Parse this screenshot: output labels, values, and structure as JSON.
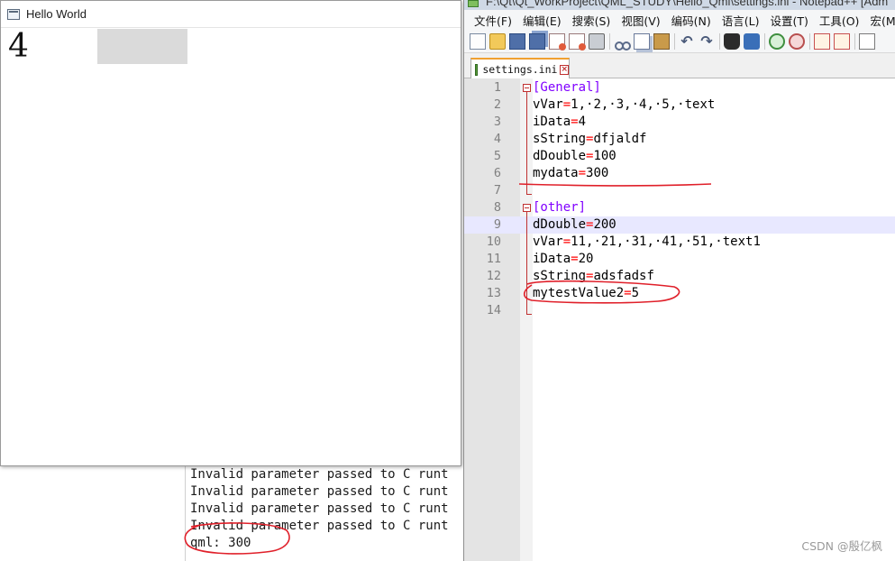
{
  "hello_window": {
    "title": "Hello World",
    "number_text": "4"
  },
  "console": {
    "lines": [
      "Invalid parameter passed to C runt",
      "Invalid parameter passed to C runt",
      "Invalid parameter passed to C runt",
      "Invalid parameter passed to C runt",
      "qml: 300"
    ]
  },
  "notepad": {
    "title": "F:\\Qt\\Qt_WorkProject\\QML_STUDY\\Hello_Qml\\settings.ini - Notepad++ [Adm",
    "menu": [
      "文件(F)",
      "编辑(E)",
      "搜索(S)",
      "视图(V)",
      "编码(N)",
      "语言(L)",
      "设置(T)",
      "工具(O)",
      "宏(M)"
    ],
    "toolbar_icons": [
      "new-file-icon",
      "open-folder-icon",
      "save-icon",
      "save-all-icon",
      "close-icon",
      "close-all-icon",
      "print-icon",
      "cut-icon",
      "copy-icon",
      "paste-icon",
      "undo-icon",
      "redo-icon",
      "find-icon",
      "replace-icon",
      "zoom-in-icon",
      "zoom-out-icon",
      "sync-scroll-icon",
      "word-wrap-icon"
    ],
    "tab": {
      "label": "settings.ini"
    },
    "lines": [
      {
        "n": "1",
        "text": "[General]",
        "type": "section"
      },
      {
        "n": "2",
        "key": "vVar",
        "value": "1,·2,·3,·4,·5,·text"
      },
      {
        "n": "3",
        "key": "iData",
        "value": "4"
      },
      {
        "n": "4",
        "key": "sString",
        "value": "dfjaldf"
      },
      {
        "n": "5",
        "key": "dDouble",
        "value": "100"
      },
      {
        "n": "6",
        "key": "mydata",
        "value": "300"
      },
      {
        "n": "7",
        "text": "",
        "type": "blank"
      },
      {
        "n": "8",
        "text": "[other]",
        "type": "section"
      },
      {
        "n": "9",
        "key": "dDouble",
        "value": "200",
        "current": true
      },
      {
        "n": "10",
        "key": "vVar",
        "value": "11,·21,·31,·41,·51,·text1"
      },
      {
        "n": "11",
        "key": "iData",
        "value": "20"
      },
      {
        "n": "12",
        "key": "sString",
        "value": "adsfadsf"
      },
      {
        "n": "13",
        "key": "mytestValue2",
        "value": "5"
      },
      {
        "n": "14",
        "text": "",
        "type": "blank"
      }
    ]
  },
  "watermark": "CSDN @殷亿枫",
  "colors": {
    "section": "#8000ff",
    "operator": "#ff0000",
    "annotation": "#e0202a",
    "current_line": "#e8e8ff"
  }
}
